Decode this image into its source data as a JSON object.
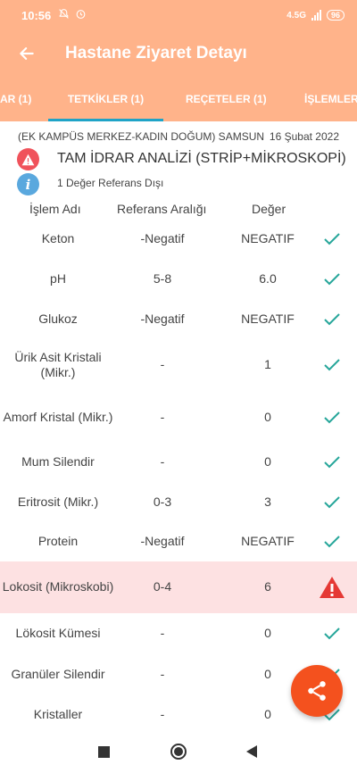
{
  "status_bar": {
    "time": "10:56",
    "network_label": "4.5G",
    "battery": "96"
  },
  "header": {
    "title": "Hastane Ziyaret Detayı",
    "background_color": "#ffb38a",
    "tabs": [
      {
        "label": "AR (1)",
        "active": false
      },
      {
        "label": "TETKİKLER (1)",
        "active": true
      },
      {
        "label": "REÇETELER (1)",
        "active": false
      },
      {
        "label": "İŞLEMLER",
        "active": false
      }
    ]
  },
  "visit": {
    "hospital": "(EK KAMPÜS MERKEZ-KADIN DOĞUM) SAMSUN",
    "date": "16 Şubat 2022",
    "test_name": "TAM İDRAR ANALİZİ (STRİP+MİKROSKOPİ)",
    "info_text": "1 Değer Referans Dışı"
  },
  "table": {
    "headers": {
      "name": "İşlem Adı",
      "range": "Referans Aralığı",
      "value": "Değer"
    },
    "rows": [
      {
        "name": "Keton",
        "range": "-Negatif",
        "value": "NEGATIF",
        "status": "normal"
      },
      {
        "name": "pH",
        "range": "5-8",
        "value": "6.0",
        "status": "normal"
      },
      {
        "name": "Glukoz",
        "range": "-Negatif",
        "value": "NEGATIF",
        "status": "normal"
      },
      {
        "name": "Ürik Asit Kristali (Mikr.)",
        "range": "-",
        "value": "1",
        "status": "normal"
      },
      {
        "name": "Amorf Kristal (Mikr.)",
        "range": "-",
        "value": "0",
        "status": "normal"
      },
      {
        "name": "Mum Silendir",
        "range": "-",
        "value": "0",
        "status": "normal"
      },
      {
        "name": "Eritrosit (Mikr.)",
        "range": "0-3",
        "value": "3",
        "status": "normal"
      },
      {
        "name": "Protein",
        "range": "-Negatif",
        "value": "NEGATIF",
        "status": "normal"
      },
      {
        "name": "Lokosit (Mikroskobi)",
        "range": "0-4",
        "value": "6",
        "status": "abnormal"
      },
      {
        "name": "Lökosit Kümesi",
        "range": "-",
        "value": "0",
        "status": "normal"
      },
      {
        "name": "Granüler Silendir",
        "range": "-",
        "value": "0",
        "status": "normal"
      },
      {
        "name": "Kristaller",
        "range": "-",
        "value": "0",
        "status": "normal"
      }
    ]
  },
  "colors": {
    "accent_tab": "#1ea3c7",
    "check": "#26a69a",
    "warning": "#e53935",
    "fab": "#f4511e",
    "abnormal_row": "#fde1e2"
  },
  "icons": {
    "back": "arrow-left-icon",
    "warning": "warning-triangle-icon",
    "info": "info-icon",
    "check": "check-icon",
    "share": "share-icon"
  }
}
